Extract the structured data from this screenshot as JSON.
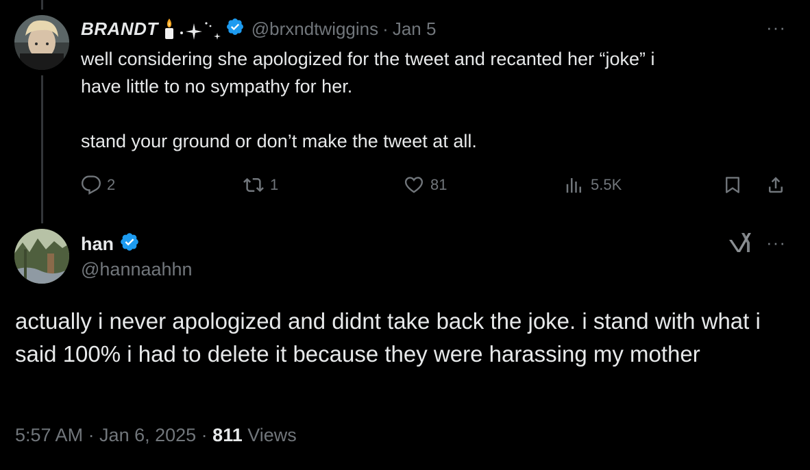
{
  "reply_tweet": {
    "display_name": "BRANDT",
    "handle": "@brxndtwiggins",
    "separator": "·",
    "date": "Jan 5",
    "text_lines": [
      "well considering she apologized for the tweet and recanted her “joke” i",
      "have little to no sympathy for her.",
      "stand your ground or don’t make the tweet at all."
    ],
    "actions": {
      "replies": "2",
      "reposts": "1",
      "likes": "81",
      "views": "5.5K"
    },
    "more_label": "···"
  },
  "main_tweet": {
    "display_name": "han",
    "handle": "@hannaahhn",
    "text": "actually i never apologized and didnt take back the joke. i stand with what i said 100% i had to delete it because they were harassing my mother",
    "timestamp": "5:57 AM · Jan 6, 2025 · ",
    "views_count": "811",
    "views_label": " Views",
    "more_label": "···"
  },
  "colors": {
    "background": "#000000",
    "text_primary": "#e7e9ea",
    "text_secondary": "#71767b",
    "verified_blue": "#1d9bf0",
    "thread_line": "#333639"
  },
  "icons": {
    "verified": "verified-badge-icon",
    "reply": "reply-bubble-icon",
    "repost": "repost-arrows-icon",
    "like": "heart-icon",
    "views": "bar-chart-icon",
    "bookmark": "bookmark-icon",
    "share": "share-upload-icon",
    "grok": "grok-icon",
    "candle": "candle-emoji-icon",
    "sparkles": "sparkles-icon"
  }
}
